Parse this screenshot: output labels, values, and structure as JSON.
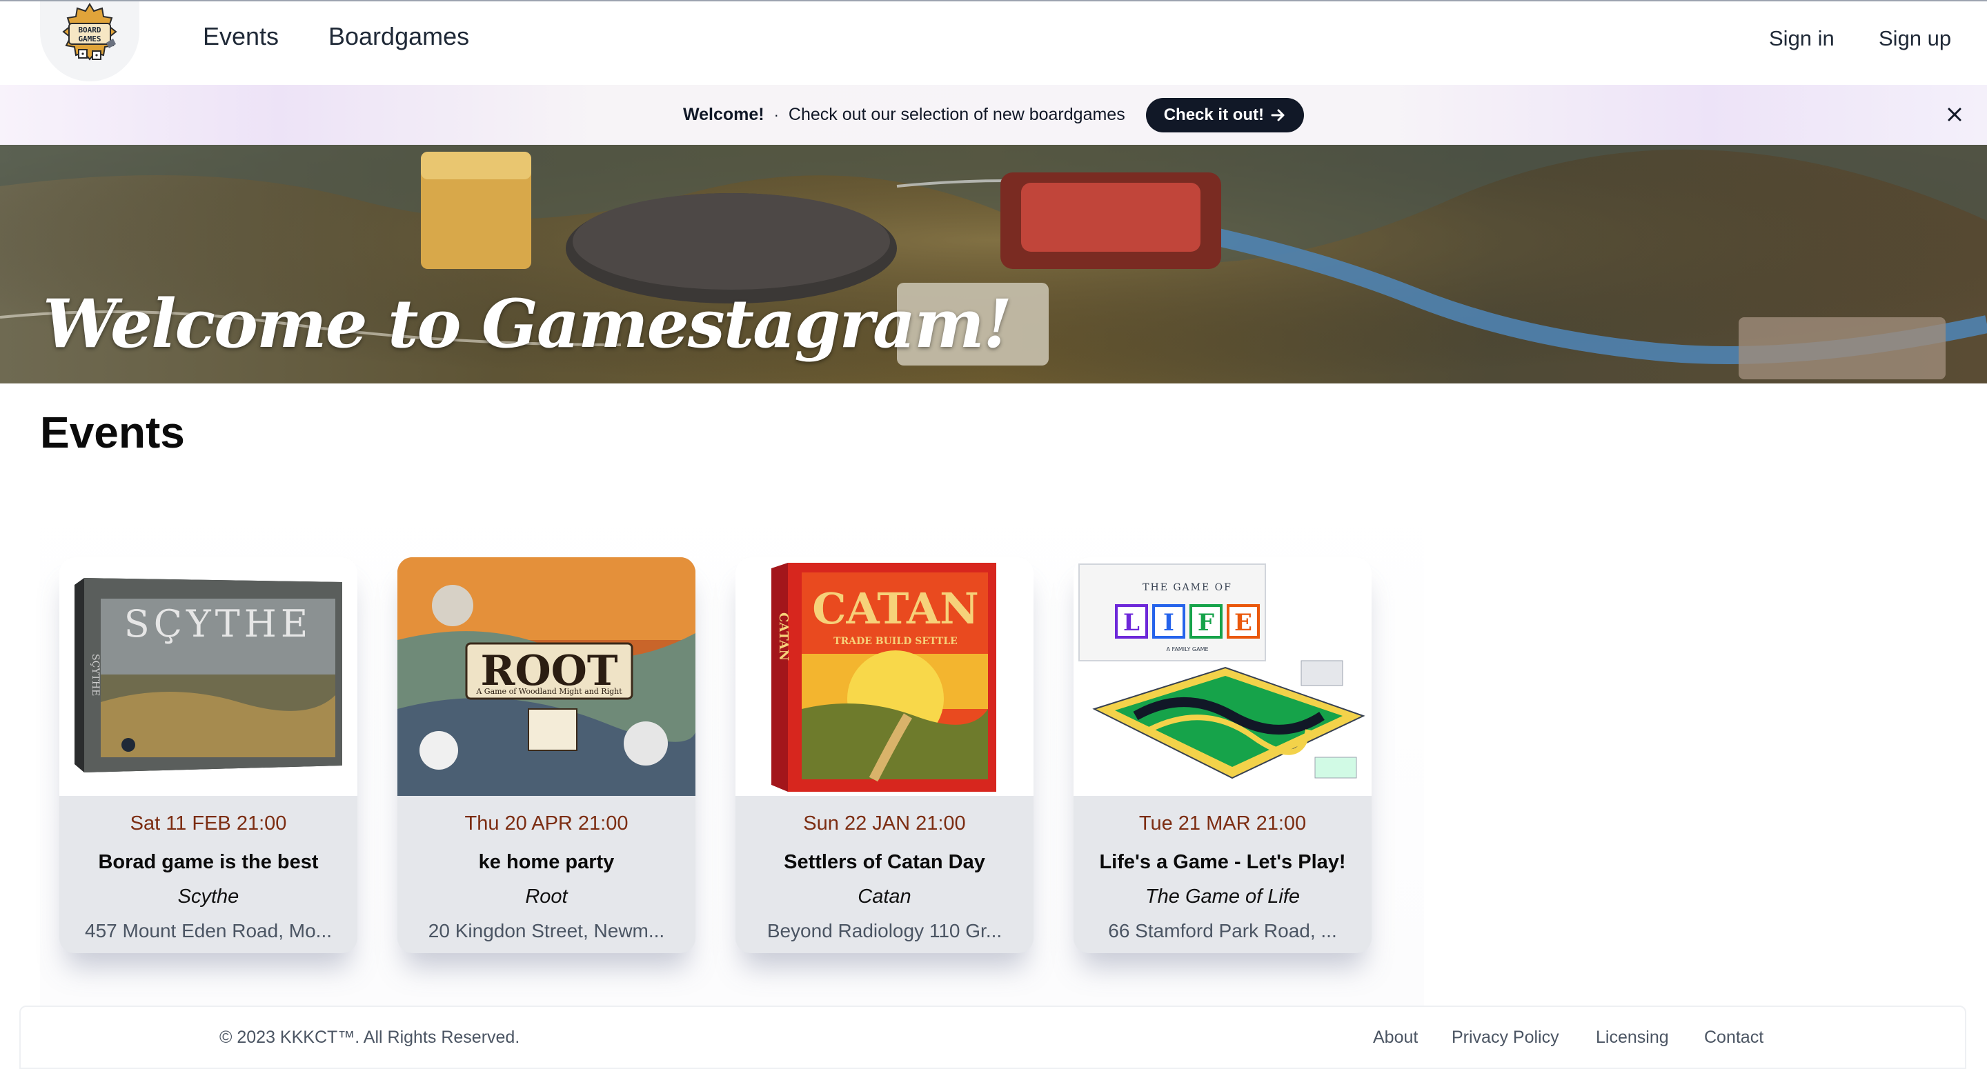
{
  "navbar": {
    "logo_text_top": "BOARD",
    "logo_text_bottom": "GAMES",
    "links": [
      {
        "label": "Events"
      },
      {
        "label": "Boardgames"
      }
    ],
    "sign_in": "Sign in",
    "sign_up": "Sign up"
  },
  "banner": {
    "strong": "Welcome!",
    "separator": "·",
    "message": "Check out our selection of new boardgames",
    "cta_label": "Check it out!",
    "cta_icon": "arrow-right-icon",
    "close_icon": "close-icon"
  },
  "hero": {
    "title": "Welcome to Gamestagram!"
  },
  "events_section": {
    "title": "Events",
    "cards": [
      {
        "date": "Sat 11 FEB 21:00",
        "name": "Borad game is the best",
        "game": "Scythe",
        "address": "457 Mount Eden Road, Mo...",
        "box_title": "SÇYTHE"
      },
      {
        "date": "Thu 20 APR 21:00",
        "name": "ke home party",
        "game": "Root",
        "address": "20 Kingdon Street, Newm...",
        "box_title": "ROOT",
        "box_subtitle": "A Game of Woodland Might and Right"
      },
      {
        "date": "Sun 22 JAN 21:00",
        "name": "Settlers of Catan Day",
        "game": "Catan",
        "address": "Beyond Radiology 110 Gr...",
        "box_title": "CATAN",
        "box_subtitle": "TRADE BUILD SETTLE",
        "box_side": "CATAN"
      },
      {
        "date": "Tue 21 MAR 21:00",
        "name": "Life's a Game - Let's Play!",
        "game": "The Game of Life",
        "address": "66 Stamford Park Road, ...",
        "box_title_top": "THE GAME OF",
        "box_letters": [
          "L",
          "I",
          "F",
          "E"
        ],
        "box_subtitle": "A FAMILY GAME"
      }
    ]
  },
  "footer": {
    "copyright": "© 2023 KKKCT™. All Rights Reserved.",
    "links": [
      "About",
      "Privacy Policy",
      "Licensing",
      "Contact"
    ]
  },
  "colors": {
    "accent_dark": "#111827",
    "date_color": "#7c2d12",
    "card_bg": "#e5e7eb"
  }
}
